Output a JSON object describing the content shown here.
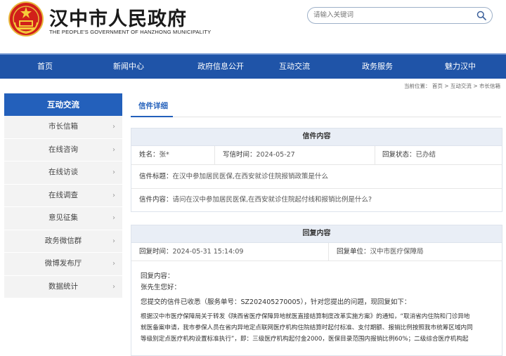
{
  "header": {
    "title": "汉中市人民政府",
    "subtitle": "THE PEOPLE'S GOVERNMENT OF HANZHONG MUNICIPALITY",
    "search_placeholder": "请输入关键词"
  },
  "nav": [
    "首页",
    "新闻中心",
    "政府信息公开",
    "互动交流",
    "政务服务",
    "魅力汉中"
  ],
  "breadcrumb": "当前位置： 首页 > 互动交流 > 市长信箱",
  "sidebar": {
    "heading": "互动交流",
    "items": [
      "市长信箱",
      "在线咨询",
      "在线访谈",
      "在线调查",
      "意见征集",
      "政务微信群",
      "微博发布厅",
      "数据统计"
    ]
  },
  "tab": "信件详细",
  "letter": {
    "heading": "信件内容",
    "name_label": "姓名：",
    "name_value": "张*",
    "time_label": "写信时间：",
    "time_value": "2024-05-27",
    "status_label": "回复状态：",
    "status_value": "已办结",
    "subject_label": "信件标题：",
    "subject_value": "在汉中参加居民医保,在西安就诊住院报销政策是什么",
    "content_label": "信件内容：",
    "content_value": "请问在汉中参加居民医保,在西安就诊住院起付线和报销比例是什么?"
  },
  "reply": {
    "heading": "回复内容",
    "time_label": "回复时间：",
    "time_value": "2024-05-31 15:14:09",
    "unit_label": "回复单位：",
    "unit_value": "汉中市医疗保障局",
    "content_label": "回复内容：",
    "greeting": "张先生您好：",
    "para1": "您提交的信件已收悉（服务单号：SZ202405270005），针对您提出的问题，现回复如下：",
    "para2_l1": "根据汉中市医疗保障局关于转发《陕西省医疗保障异地就医直接结算制度改革实施方案》的通知，“取消省内住院和门诊异地",
    "para2_l2": "就医备案申请，我市参保人员在省内异地定点联网医疗机构住院结算时起付标准、支付期额、报销比例按照我市统筹区域内同",
    "para2_l3": "等级别定点医疗机构设置标准执行”，即：三级医疗机构起付金2000，医保目录范围内报销比例60%；二级综合医疗机构起"
  }
}
